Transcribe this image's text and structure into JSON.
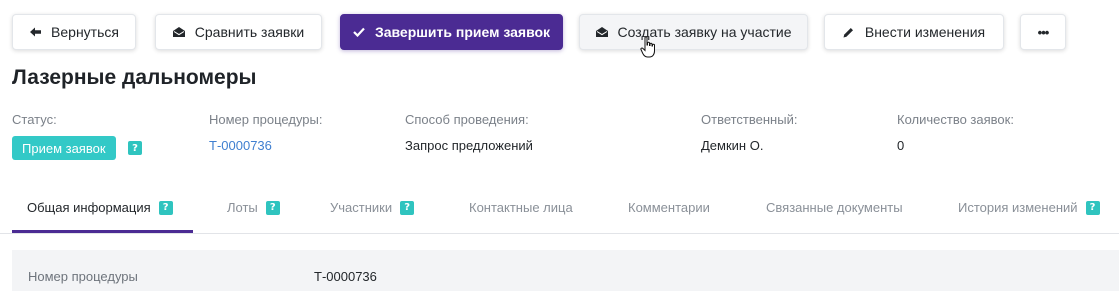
{
  "toolbar": {
    "back_label": "Вернуться",
    "compare_label": "Сравнить заявки",
    "finish_label": "Завершить прием заявок",
    "create_label": "Создать заявку на участие",
    "edit_label": "Внести изменения",
    "more_label": "•••"
  },
  "page_title": "Лазерные дальномеры",
  "info": {
    "status_label": "Статус:",
    "status_value": "Прием заявок",
    "procedure_label": "Номер процедуры:",
    "procedure_value": "Т-0000736",
    "method_label": "Способ проведения:",
    "method_value": "Запрос предложений",
    "responsible_label": "Ответственный:",
    "responsible_value": "Демкин О.",
    "count_label": "Количество заявок:",
    "count_value": "0"
  },
  "help_glyph": "?",
  "tabs": [
    {
      "label": "Общая информация"
    },
    {
      "label": "Лоты"
    },
    {
      "label": "Участники"
    },
    {
      "label": "Контактные лица"
    },
    {
      "label": "Комментарии"
    },
    {
      "label": "Связанные документы"
    },
    {
      "label": "История изменений"
    }
  ],
  "details": {
    "procedure_label": "Номер процедуры",
    "procedure_value": "Т-0000736"
  },
  "colors": {
    "primary": "#4b2b93",
    "status_badge": "#33c9c7",
    "link": "#3f7fd0"
  }
}
